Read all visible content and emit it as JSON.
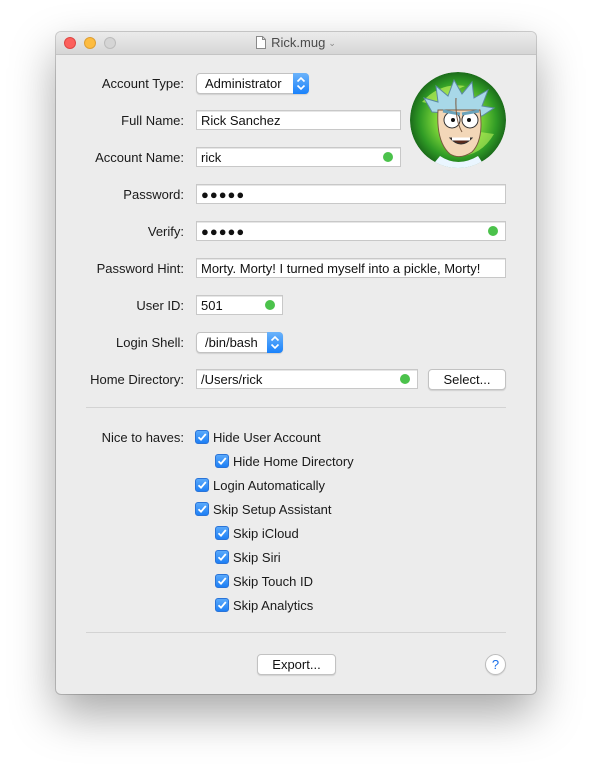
{
  "window": {
    "title": "Rick.mug"
  },
  "form": {
    "account_type": {
      "label": "Account Type:",
      "value": "Administrator"
    },
    "full_name": {
      "label": "Full Name:",
      "value": "Rick Sanchez"
    },
    "account_name": {
      "label": "Account Name:",
      "value": "rick"
    },
    "password": {
      "label": "Password:",
      "value": "●●●●●"
    },
    "verify": {
      "label": "Verify:",
      "value": "●●●●●"
    },
    "password_hint": {
      "label": "Password Hint:",
      "value": "Morty. Morty! I turned myself into a pickle, Morty!"
    },
    "user_id": {
      "label": "User ID:",
      "value": "501"
    },
    "login_shell": {
      "label": "Login Shell:",
      "value": "/bin/bash"
    },
    "home_directory": {
      "label": "Home Directory:",
      "value": "/Users/rick",
      "select_label": "Select..."
    }
  },
  "options": {
    "label": "Nice to haves:",
    "items": [
      {
        "label": "Hide User Account",
        "checked": true
      },
      {
        "label": "Hide Home Directory",
        "checked": true
      },
      {
        "label": "Login Automatically",
        "checked": true
      },
      {
        "label": "Skip Setup Assistant",
        "checked": true
      },
      {
        "label": "Skip iCloud",
        "checked": true
      },
      {
        "label": "Skip Siri",
        "checked": true
      },
      {
        "label": "Skip Touch ID",
        "checked": true
      },
      {
        "label": "Skip Analytics",
        "checked": true
      }
    ]
  },
  "footer": {
    "export_label": "Export...",
    "help_label": "?"
  },
  "colors": {
    "accent": "#1a82fb",
    "valid": "#4bc24b",
    "window_bg": "#ececec"
  },
  "icons": {
    "document": "document-icon",
    "help": "help-icon",
    "avatar": "user-avatar-image"
  }
}
